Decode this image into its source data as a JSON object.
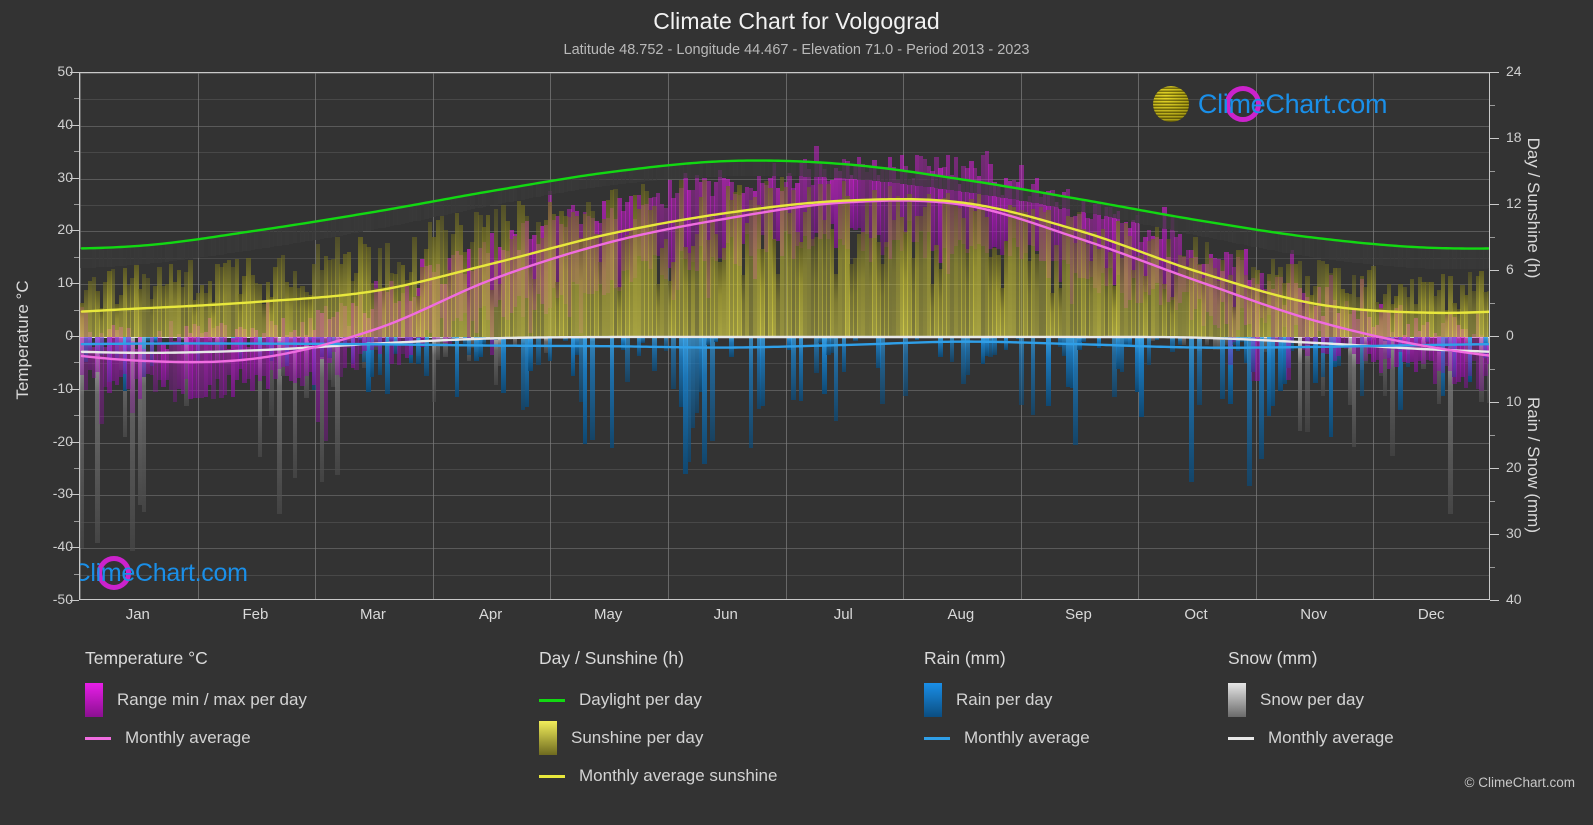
{
  "header": {
    "title": "Climate Chart for Volgograd",
    "subtitle": "Latitude 48.752 - Longitude 44.467 - Elevation 71.0 - Period 2013 - 2023"
  },
  "branding": {
    "name": "ClimeChart.com",
    "copyright": "© ClimeChart.com",
    "logo_c_color": "#cc22cc",
    "logo_ball_color": "#d8cc22",
    "logo_text_color": "#1a8fe8"
  },
  "axes": {
    "left_title": "Temperature °C",
    "right_top_title": "Day / Sunshine (h)",
    "right_bottom_title": "Rain / Snow (mm)",
    "left_ticks": [
      50,
      40,
      30,
      20,
      10,
      0,
      -10,
      -20,
      -30,
      -40,
      -50
    ],
    "right_top_ticks": [
      24,
      18,
      12,
      6,
      0
    ],
    "right_bottom_ticks": [
      10,
      20,
      30,
      40
    ],
    "left_range": [
      -50,
      50
    ],
    "right_top_range": [
      0,
      24
    ],
    "right_bottom_range": [
      0,
      40
    ]
  },
  "legend": {
    "groups": [
      {
        "title": "Temperature °C",
        "items": [
          {
            "label": "Range min / max per day",
            "marker": "box",
            "color": "#e81ee8",
            "color2": "#8a1090"
          },
          {
            "label": "Monthly average",
            "marker": "line",
            "color": "#f06ce0"
          }
        ]
      },
      {
        "title": "Day / Sunshine (h)",
        "items": [
          {
            "label": "Daylight per day",
            "marker": "line",
            "color": "#12d912"
          },
          {
            "label": "Sunshine per day",
            "marker": "box",
            "color": "#f2ee5a",
            "color2": "#6e6a20"
          },
          {
            "label": "Monthly average sunshine",
            "marker": "line",
            "color": "#e8e83c"
          }
        ]
      },
      {
        "title": "Rain (mm)",
        "items": [
          {
            "label": "Rain per day",
            "marker": "box",
            "color": "#1a8fe8",
            "color2": "#0b4d80"
          },
          {
            "label": "Monthly average",
            "marker": "line",
            "color": "#2f9fe8"
          }
        ]
      },
      {
        "title": "Snow (mm)",
        "items": [
          {
            "label": "Snow per day",
            "marker": "box",
            "color": "#e6e6e6",
            "color2": "#6a6a6a"
          },
          {
            "label": "Monthly average",
            "marker": "line",
            "color": "#e8e8e8"
          }
        ]
      }
    ]
  },
  "chart_data": {
    "type": "line",
    "title": "Climate Chart for Volgograd",
    "subtitle": "Latitude 48.752 - Longitude 44.467 - Elevation 71.0 - Period 2013 - 2023",
    "xlabel": "",
    "ylabel": "Temperature °C",
    "y2label_top": "Day / Sunshine (h)",
    "y2label_bottom": "Rain / Snow (mm)",
    "ylim": [
      -50,
      50
    ],
    "y2lim_top": [
      0,
      24
    ],
    "y2lim_bottom": [
      0,
      40
    ],
    "grid": true,
    "legend_position": "below",
    "categories": [
      "Jan",
      "Feb",
      "Mar",
      "Apr",
      "May",
      "Jun",
      "Jul",
      "Aug",
      "Sep",
      "Oct",
      "Nov",
      "Dec"
    ],
    "series": [
      {
        "name": "Daylight per day",
        "unit": "h",
        "axis": "right_top",
        "color": "#12d912",
        "values": [
          8.3,
          9.7,
          11.4,
          13.3,
          15.0,
          16.0,
          15.7,
          14.3,
          12.5,
          10.6,
          9.0,
          8.1
        ]
      },
      {
        "name": "Monthly average sunshine",
        "unit": "h",
        "axis": "right_top",
        "color": "#e8e83c",
        "values": [
          2.6,
          3.2,
          4.2,
          6.7,
          9.4,
          11.3,
          12.4,
          12.2,
          9.6,
          5.9,
          3.0,
          2.2
        ]
      },
      {
        "name": "Monthly average temperature",
        "unit": "°C",
        "axis": "left",
        "color": "#f06ce0",
        "values": [
          -4.5,
          -4.0,
          1.5,
          11.0,
          18.0,
          22.5,
          25.5,
          25.0,
          18.5,
          10.5,
          3.0,
          -2.0
        ]
      },
      {
        "name": "Monthly average rain",
        "unit": "mm",
        "axis": "right_bottom",
        "color": "#2f9fe8",
        "values": [
          1.0,
          1.0,
          1.1,
          1.3,
          1.4,
          1.6,
          1.2,
          0.7,
          1.1,
          1.6,
          1.5,
          1.2
        ]
      },
      {
        "name": "Monthly average snow",
        "unit": "mm",
        "axis": "right_bottom",
        "color": "#e8e8e8",
        "values": [
          2.4,
          2.0,
          1.0,
          0.2,
          0.0,
          0.0,
          0.0,
          0.0,
          0.0,
          0.1,
          0.9,
          1.9
        ]
      }
    ],
    "daily_bands": [
      {
        "name": "Range min / max per day",
        "unit": "°C",
        "axis": "left",
        "color": "#e81ee8",
        "monthly_min": [
          -9.0,
          -8.5,
          -3.0,
          4.0,
          11.0,
          16.0,
          19.0,
          18.0,
          12.0,
          5.0,
          -1.0,
          -6.0
        ],
        "monthly_max": [
          0.0,
          0.5,
          6.5,
          17.0,
          24.0,
          29.0,
          32.0,
          31.5,
          24.5,
          15.5,
          7.0,
          2.0
        ],
        "extreme_min": [
          -26.0,
          -24.0,
          -17.0,
          -5.0,
          2.0,
          8.0,
          12.0,
          11.0,
          3.0,
          -4.0,
          -14.0,
          -22.0
        ],
        "extreme_max": [
          7.0,
          9.0,
          16.0,
          27.0,
          33.0,
          37.0,
          39.0,
          38.0,
          33.0,
          25.0,
          17.0,
          10.0
        ]
      },
      {
        "name": "Sunshine per day",
        "unit": "h",
        "axis": "right_top",
        "color": "#d8d43c",
        "monthly_max": [
          6.6,
          8.0,
          9.8,
          12.0,
          13.8,
          14.6,
          14.4,
          13.2,
          11.4,
          9.2,
          7.2,
          6.2
        ]
      },
      {
        "name": "Rain per day",
        "unit": "mm",
        "axis": "right_bottom",
        "color": "#1a8fe8",
        "monthly_peak": [
          9.0,
          8.0,
          10.0,
          14.0,
          18.0,
          22.0,
          20.0,
          12.0,
          17.0,
          24.0,
          19.0,
          14.0
        ]
      },
      {
        "name": "Snow per day",
        "unit": "mm",
        "axis": "right_bottom",
        "color": "#bdbdbd",
        "monthly_peak": [
          33.0,
          30.0,
          22.0,
          8.0,
          0.0,
          0.0,
          0.0,
          0.0,
          0.0,
          3.0,
          18.0,
          30.0
        ]
      }
    ]
  }
}
